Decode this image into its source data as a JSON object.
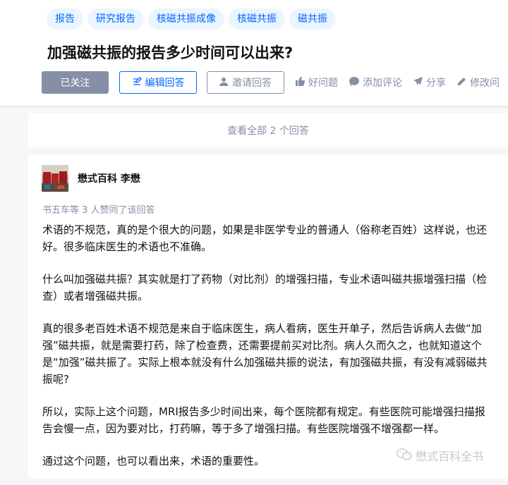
{
  "tags": [
    "报告",
    "研究报告",
    "核磁共振成像",
    "核磁共振",
    "磁共振"
  ],
  "question": {
    "title": "加强磁共振的报告多少时间可以出来?"
  },
  "actions": {
    "followed": "已关注",
    "edit_answer": "编辑回答",
    "invite": "邀请回答",
    "good_question": "好问题",
    "add_comment": "添加评论",
    "share": "分享",
    "modify": "修改问"
  },
  "view_all": "查看全部 2 个回答",
  "answer": {
    "author": "懋式百科 李懋",
    "voters": "书五车等 3 人赞同了该回答",
    "paragraphs": [
      "术语的不规范，真的是个很大的问题，如果是非医学专业的普通人（俗称老百姓）这样说，也还好。很多临床医生的术语也不准确。",
      "什么叫加强磁共振？其实就是打了药物（对比剂）的增强扫描，专业术语叫磁共振增强扫描（检查）或者增强磁共振。",
      "真的很多老百姓术语不规范是来自于临床医生，病人看病，医生开单子，然后告诉病人去做“加强”磁共振，就是需要打药，除了检查费，还需要提前买对比剂。病人久而久之，也就知道这个是“加强”磁共振了。实际上根本就没有什么加强磁共振的说法，有加强磁共振，有没有减弱磁共振呢?",
      "所以，实际上这个问题，MRI报告多少时间出来，每个医院都有规定。有些医院可能增强扫描报告会慢一点，因为要对比，打药嘛，等于多了增强扫描。有些医院增强不增强都一样。",
      "通过这个问题，也可以看出来，术语的重要性。"
    ]
  },
  "watermark": "懋式百科全书",
  "icons": {
    "edit": "edit-icon",
    "invite": "person-icon",
    "like": "thumbs-up-icon",
    "comment": "comment-icon",
    "share": "paper-plane-icon",
    "modify": "pencil-icon",
    "watermark": "wechat-icon"
  }
}
